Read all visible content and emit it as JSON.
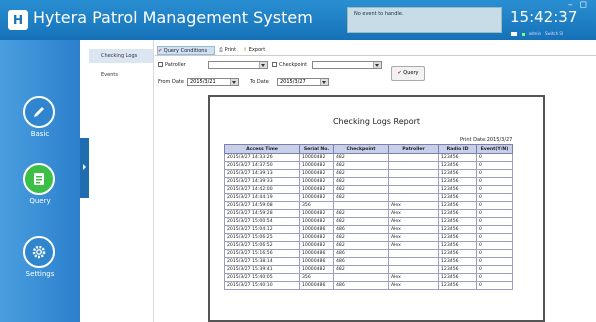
{
  "app": {
    "title": "Hytera Patrol Management System",
    "logo": "H",
    "notice": "No event to handle.",
    "clock": "15:42:37",
    "window_buttons": "– ◻",
    "user": "admin",
    "switch": "Switch Sl"
  },
  "sidebar": {
    "items": [
      {
        "label": "Basic",
        "icon": "pencil-icon"
      },
      {
        "label": "Query",
        "icon": "clipboard-icon"
      },
      {
        "label": "Settings",
        "icon": "gear-icon"
      }
    ]
  },
  "subnav": {
    "items": [
      "Checking Logs",
      "Events"
    ]
  },
  "toolbar": {
    "query_conditions": "Query Conditions",
    "print": "Print",
    "export": "Export"
  },
  "filters": {
    "patroller_label": "Patroller",
    "checkpoint_label": "Checkpoint",
    "from_label": "From Date",
    "from_value": "2015/3/21",
    "to_label": "To Date",
    "to_value": "2015/3/27",
    "query_button": "Query"
  },
  "report": {
    "title": "Checking Logs Report",
    "print_date": "Print Date:2015/3/27",
    "columns": [
      "Access Time",
      "Serial No.",
      "Checkpoint",
      "Patroller",
      "Radio ID",
      "Event(Y/N)"
    ],
    "rows": [
      [
        "2015/3/27 14:33:26",
        "10000482",
        "482",
        "",
        "123456",
        "0"
      ],
      [
        "2015/3/27 14:37:50",
        "10000482",
        "482",
        "",
        "123456",
        "0"
      ],
      [
        "2015/3/27 14:39:13",
        "10000482",
        "482",
        "",
        "123456",
        "0"
      ],
      [
        "2015/3/27 14:39:33",
        "10000482",
        "482",
        "",
        "123456",
        "0"
      ],
      [
        "2015/3/27 14:42:00",
        "10000482",
        "482",
        "",
        "123456",
        "0"
      ],
      [
        "2015/3/27 14:44:19",
        "10000482",
        "482",
        "",
        "123456",
        "0"
      ],
      [
        "2015/3/27 14:59:08",
        "356",
        "",
        "Alex",
        "123456",
        "0"
      ],
      [
        "2015/3/27 14:59:28",
        "10000482",
        "482",
        "Alex",
        "123456",
        "0"
      ],
      [
        "2015/3/27 15:00:54",
        "10000482",
        "482",
        "Alex",
        "123456",
        "0"
      ],
      [
        "2015/3/27 15:04:12",
        "10000486",
        "486",
        "Alex",
        "123456",
        "0"
      ],
      [
        "2015/3/27 15:06:25",
        "10000482",
        "482",
        "Alex",
        "123456",
        "0"
      ],
      [
        "2015/3/27 15:06:52",
        "10000482",
        "482",
        "Alex",
        "123456",
        "0"
      ],
      [
        "2015/3/27 15:16:56",
        "10000486",
        "486",
        "",
        "123456",
        "0"
      ],
      [
        "2015/3/27 15:38:14",
        "10000486",
        "486",
        "",
        "123456",
        "0"
      ],
      [
        "2015/3/27 15:39:41",
        "10000482",
        "482",
        "",
        "123456",
        "0"
      ],
      [
        "2015/3/27 15:40:05",
        "356",
        "",
        "Alex",
        "123456",
        "0"
      ],
      [
        "2015/3/27 15:40:10",
        "10000486",
        "486",
        "Alex",
        "123456",
        "0"
      ]
    ]
  },
  "colors": {
    "title_bar": "#1672b8",
    "sidebar": "#2c7fcc",
    "active_nav": "#3cbf46",
    "header_row": "#c9cfe9"
  }
}
